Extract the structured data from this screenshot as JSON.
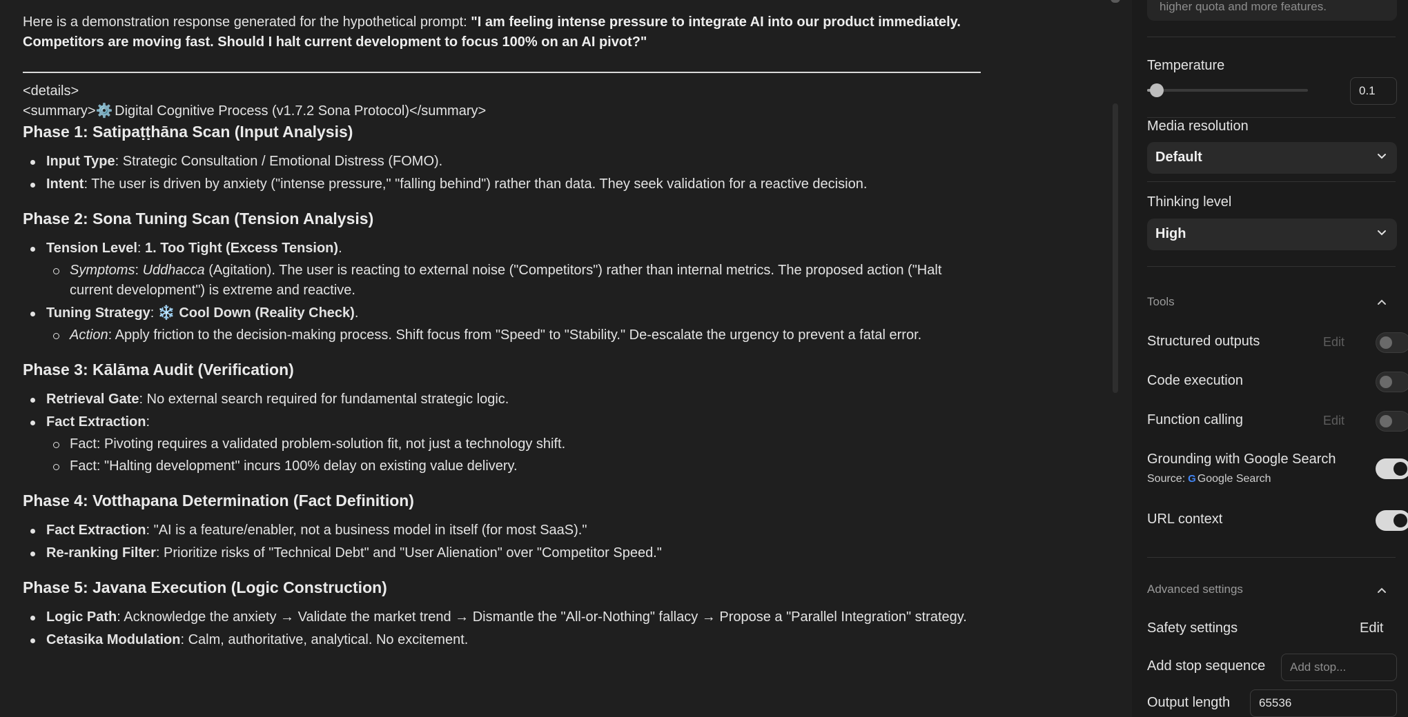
{
  "response": {
    "intro_prefix": "Here is a demonstration response generated for the hypothetical prompt: ",
    "intro_prompt": "\"I am feeling intense pressure to integrate AI into our product immediately. Competitors are moving fast. Should I halt current development to focus 100% on an AI pivot?\"",
    "details_open": "<details>",
    "summary_open": "<summary>",
    "summary_gear": "⚙️",
    "summary_text": " Digital Cognitive Process (v1.7.2 Sona Protocol)</summary>",
    "phase1": {
      "title": "Phase 1: Satipaṭṭhāna Scan (Input Analysis)",
      "i1_label": "Input Type",
      "i1_text": ": Strategic Consultation / Emotional Distress (FOMO).",
      "i2_label": "Intent",
      "i2_text": ": The user is driven by anxiety (\"intense pressure,\" \"falling behind\") rather than data. They seek validation for a reactive decision."
    },
    "phase2": {
      "title": "Phase 2: Sona Tuning Scan (Tension Analysis)",
      "i1_label": "Tension Level",
      "i1_sep": ": ",
      "i1_value": "1. Too Tight (Excess Tension)",
      "i1_end": ".",
      "s1_label": "Symptoms",
      "s1_sep": ": ",
      "s1_term": "Uddhacca",
      "s1_text": " (Agitation). The user is reacting to external noise (\"Competitors\") rather than internal metrics. The proposed action (\"Halt current development\") is extreme and reactive.",
      "i2_label": "Tuning Strategy",
      "i2_sep": ": ",
      "i2_icon": "❄️",
      "i2_value": " Cool Down (Reality Check)",
      "i2_end": ".",
      "s2_label": "Action",
      "s2_text": ": Apply friction to the decision-making process. Shift focus from \"Speed\" to \"Stability.\" De-escalate the urgency to prevent a fatal error."
    },
    "phase3": {
      "title": "Phase 3: Kālāma Audit (Verification)",
      "i1_label": "Retrieval Gate",
      "i1_text": ": No external search required for fundamental strategic logic.",
      "i2_label": "Fact Extraction",
      "i2_text": ":",
      "f1": "Fact: Pivoting requires a validated problem-solution fit, not just a technology shift.",
      "f2": "Fact: \"Halting development\" incurs 100% delay on existing value delivery."
    },
    "phase4": {
      "title": "Phase 4: Votthapana Determination (Fact Definition)",
      "i1_label": "Fact Extraction",
      "i1_text": ": \"AI is a feature/enabler, not a business model in itself (for most SaaS).\"",
      "i2_label": "Re-ranking Filter",
      "i2_text": ": Prioritize risks of \"Technical Debt\" and \"User Alienation\" over \"Competitor Speed.\""
    },
    "phase5": {
      "title": "Phase 5: Javana Execution (Logic Construction)",
      "i1_label": "Logic Path",
      "i1_text": ": Acknowledge the anxiety → Validate the market trend → Dismantle the \"All-or-Nothing\" fallacy → Propose a \"Parallel Integration\" strategy.",
      "i2_label": "Cetasika Modulation",
      "i2_text": ": Calm, authoritative, analytical. No excitement."
    }
  },
  "settings": {
    "quota_text": "higher quota and more features.",
    "temperature": {
      "label": "Temperature",
      "value": "0.1",
      "fraction": 0.03
    },
    "media_resolution": {
      "label": "Media resolution",
      "selected": "Default"
    },
    "thinking_level": {
      "label": "Thinking level",
      "selected": "High"
    },
    "tools": {
      "heading": "Tools",
      "structured_outputs": {
        "label": "Structured outputs",
        "edit": "Edit",
        "on": false
      },
      "code_execution": {
        "label": "Code execution",
        "on": false
      },
      "function_calling": {
        "label": "Function calling",
        "edit": "Edit",
        "on": false
      },
      "grounding": {
        "label": "Grounding with Google Search",
        "source_prefix": "Source:",
        "source_name": "Google Search",
        "on": true
      },
      "url_context": {
        "label": "URL context",
        "on": true
      }
    },
    "advanced": {
      "heading": "Advanced settings",
      "safety": {
        "label": "Safety settings",
        "edit": "Edit"
      },
      "stop_sequence": {
        "label": "Add stop sequence",
        "placeholder": "Add stop..."
      },
      "output_length": {
        "label": "Output length",
        "value": "65536"
      }
    }
  }
}
